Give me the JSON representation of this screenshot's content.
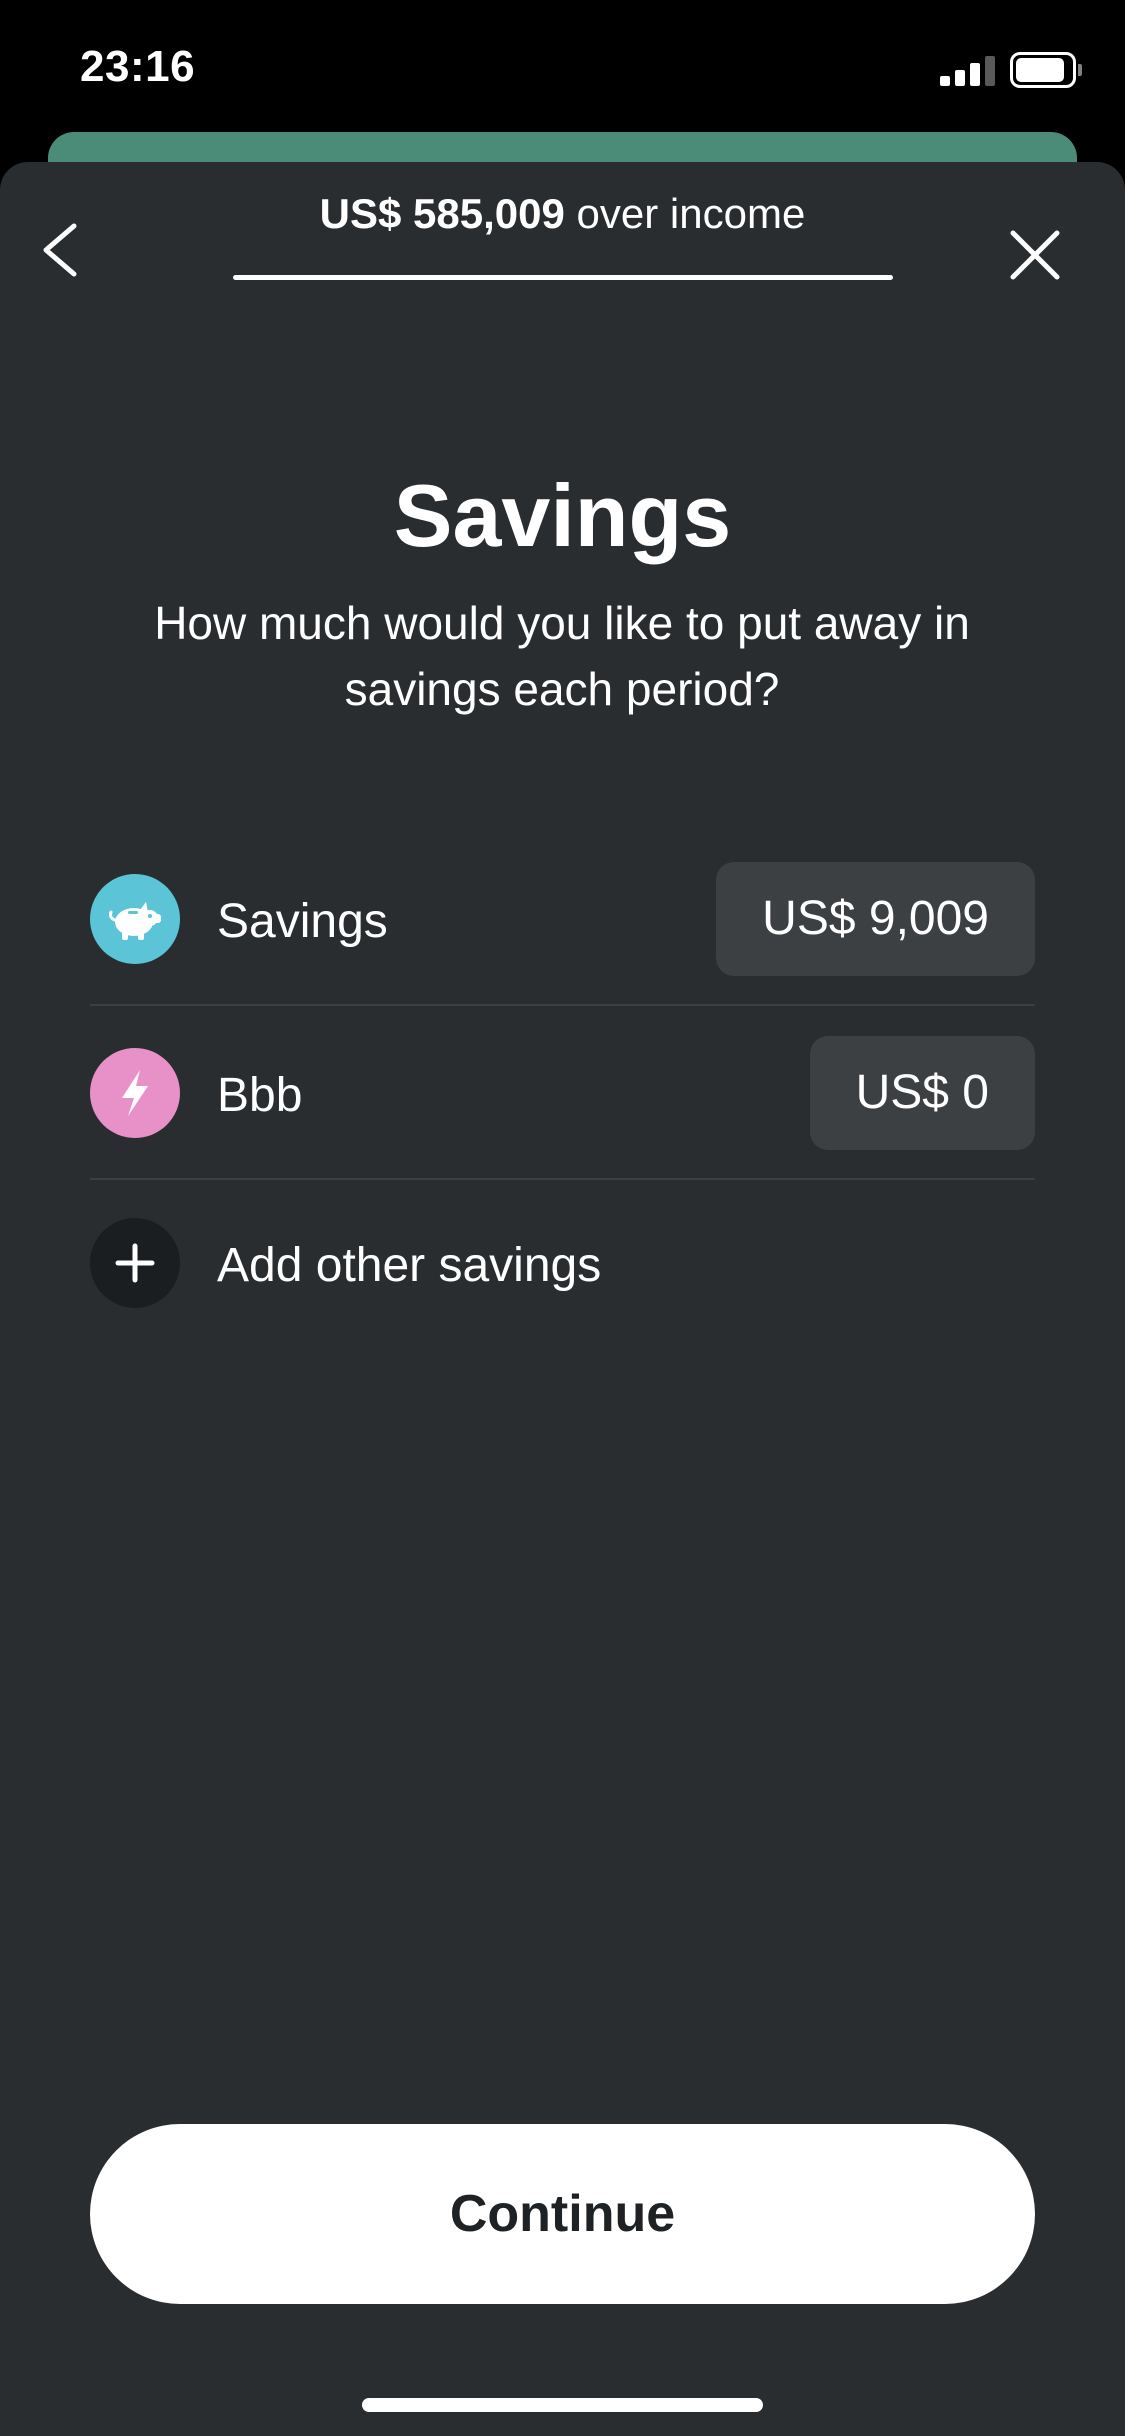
{
  "status_bar": {
    "time": "23:16",
    "signal_icon": "cellular-signal-icon",
    "battery_icon": "battery-icon"
  },
  "header": {
    "amount": "US$ 585,009",
    "suffix": " over income",
    "back_icon": "chevron-left-icon",
    "close_icon": "close-icon"
  },
  "page": {
    "title": "Savings",
    "subtitle": "How much would you like to put away in savings each period?"
  },
  "savings_items": [
    {
      "label": "Savings",
      "amount": "US$ 9,009",
      "icon": "piggy-bank-icon",
      "icon_color": "#5bc4d6"
    },
    {
      "label": "Bbb",
      "amount": "US$ 0",
      "icon": "lightning-bolt-icon",
      "icon_color": "#e891c9"
    }
  ],
  "add_row": {
    "label": "Add other savings",
    "icon": "plus-icon"
  },
  "footer": {
    "continue_label": "Continue"
  },
  "colors": {
    "background": "#292d30",
    "back_sheet": "#4b8c78",
    "amount_field": "#3d4043"
  }
}
